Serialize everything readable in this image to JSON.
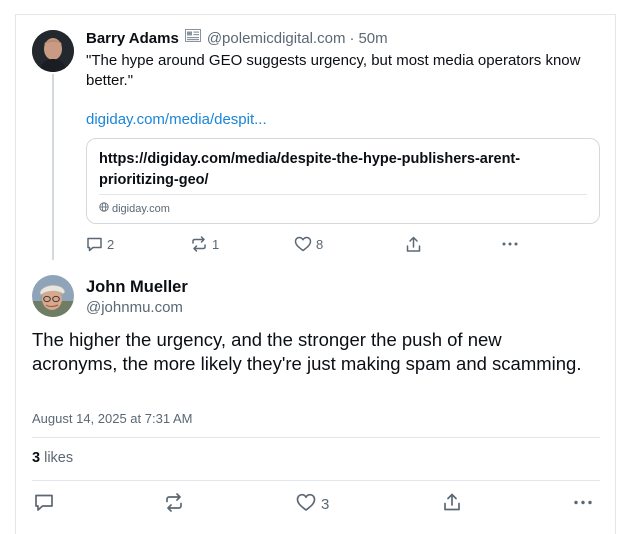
{
  "reply_parent": {
    "author_name": "Barry Adams",
    "author_handle": "@polemicdigital.com",
    "separator": "·",
    "time_ago": "50m",
    "text": "\"The hype around GEO suggests urgency, but most media operators know better.\"",
    "link_text": "digiday.com/media/despit...",
    "embed": {
      "title": "https://digiday.com/media/despite-the-hype-publishers-arent-prioritizing-geo/",
      "domain": "digiday.com"
    },
    "actions": {
      "replies": "2",
      "reposts": "1",
      "likes": "8"
    }
  },
  "main_post": {
    "author_name": "John Mueller",
    "author_handle": "@johnmu.com",
    "text": "The higher the urgency, and the stronger the push of new acronyms, the more likely they're just making spam and scamming.",
    "timestamp": "August 14, 2025 at 7:31 AM",
    "likes_count": "3",
    "likes_label": "likes",
    "actions": {
      "likes": "3"
    }
  },
  "icons": {
    "badge": "feed-badge-icon",
    "reply": "reply-icon",
    "repost": "repost-icon",
    "like": "heart-icon",
    "share": "share-icon",
    "more": "more-icon",
    "globe": "globe-icon"
  },
  "colors": {
    "link": "#1a85d9",
    "muted": "#5b6874",
    "text": "#0b0f14",
    "border": "#e3e7eb"
  }
}
